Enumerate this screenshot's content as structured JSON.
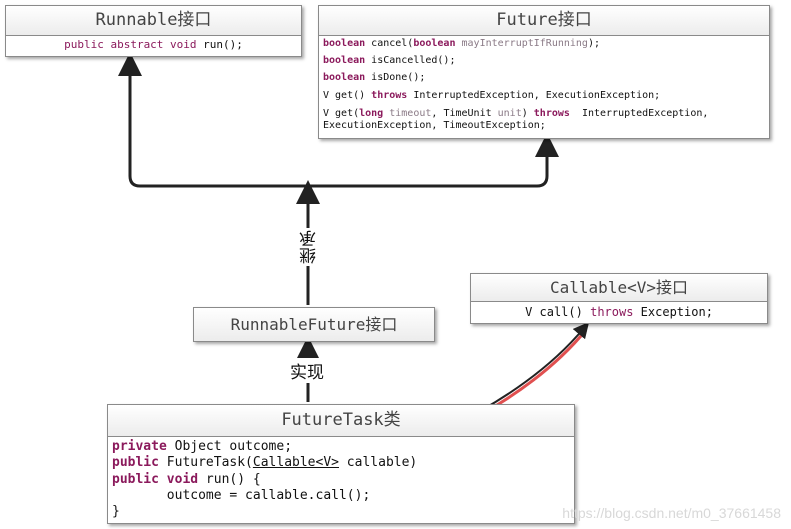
{
  "runnable": {
    "title": "Runnable接口",
    "lines": [
      "public abstract void run();"
    ]
  },
  "future": {
    "title": "Future接口",
    "lines": [
      "boolean cancel(boolean mayInterruptIfRunning);",
      "boolean isCancelled();",
      "boolean isDone();",
      "V get() throws InterruptedException, ExecutionException;",
      "V get(long timeout, TimeUnit unit) throws  InterruptedException,",
      "ExecutionException, TimeoutException;"
    ]
  },
  "runnable_future": {
    "title": "RunnableFuture接口"
  },
  "callable": {
    "title": "Callable<V>接口",
    "lines": [
      "V call() throws Exception;"
    ]
  },
  "future_task": {
    "title": "FutureTask类",
    "lines": [
      "private Object outcome;",
      "public FutureTask(Callable<V> callable)",
      "public void run() {",
      "       outcome = callable.call();",
      "}"
    ]
  },
  "labels": {
    "inherit": "继承",
    "implement": "实现"
  },
  "watermark": "https://blog.csdn.net/m0_37661458",
  "colors": {
    "keyword": "#8b1a5c",
    "link_curve": "#e05050"
  }
}
